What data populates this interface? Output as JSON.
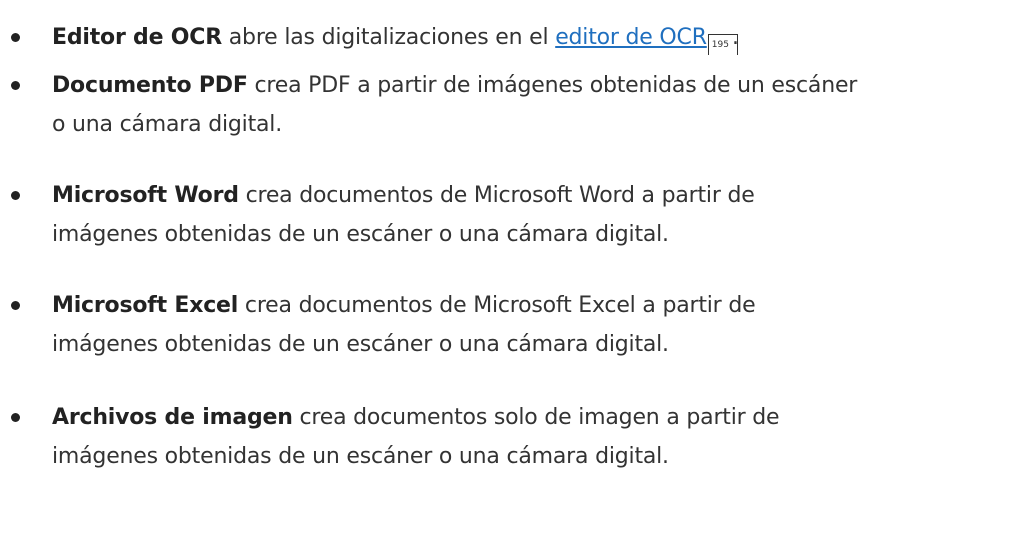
{
  "items": [
    {
      "term": "Editor de OCR",
      "text": " abre las digitalizaciones en el ",
      "link": "editor de OCR",
      "page_ref": "195",
      "tail": "."
    },
    {
      "term": "Documento PDF",
      "text": " crea PDF a partir de imágenes obtenidas de un escáner",
      "line2": "o una cámara digital."
    },
    {
      "term": "Microsoft Word",
      "text": " crea documentos de Microsoft Word a partir de",
      "line2": "imágenes obtenidas de un escáner o una cámara digital."
    },
    {
      "term": "Microsoft Excel",
      "text": " crea documentos de Microsoft Excel a partir de",
      "line2": "imágenes obtenidas de un escáner o una cámara digital."
    },
    {
      "term": "Archivos de imagen",
      "text": " crea documentos solo de imagen a partir de",
      "line2": "imágenes obtenidas de un escáner o una cámara digital."
    }
  ],
  "colors": {
    "text": "#333333",
    "term": "#222222",
    "link": "#1f6fbf",
    "background": "#ffffff"
  }
}
